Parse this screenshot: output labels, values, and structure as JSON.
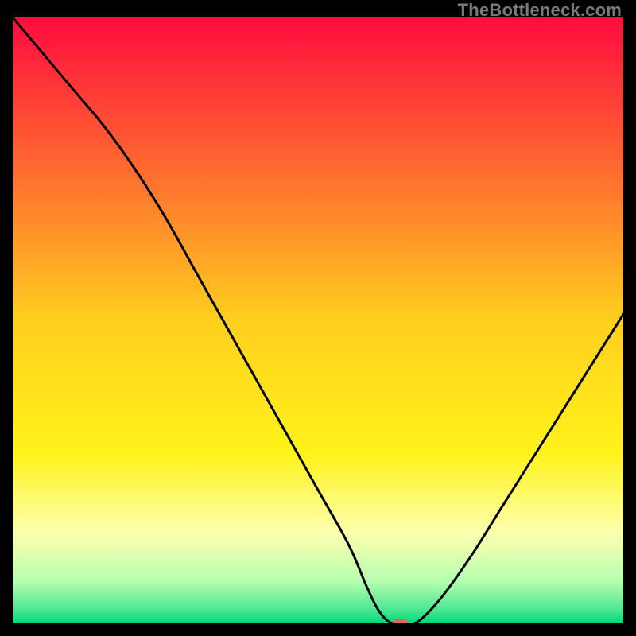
{
  "watermark": "TheBottleneck.com",
  "chart_data": {
    "type": "line",
    "title": "",
    "xlabel": "",
    "ylabel": "",
    "xlim": [
      0,
      100
    ],
    "ylim": [
      0,
      100
    ],
    "x": [
      0,
      5,
      10,
      15,
      20,
      25,
      30,
      35,
      40,
      45,
      50,
      55,
      58,
      60,
      62,
      64,
      66,
      70,
      75,
      80,
      85,
      90,
      95,
      100
    ],
    "values": [
      100,
      94,
      88,
      82,
      75,
      67,
      58,
      49,
      40,
      31,
      22,
      13,
      6,
      2,
      0,
      0,
      0,
      4,
      11,
      19,
      27,
      35,
      43,
      51
    ],
    "series_name": "bottleneck-curve",
    "gradient_stops": [
      {
        "offset": 0.0,
        "color": "#ff0b3e"
      },
      {
        "offset": 0.25,
        "color": "#ff6a30"
      },
      {
        "offset": 0.5,
        "color": "#ffcf1e"
      },
      {
        "offset": 0.72,
        "color": "#fff31a"
      },
      {
        "offset": 0.85,
        "color": "#fdffae"
      },
      {
        "offset": 0.93,
        "color": "#b6ffb0"
      },
      {
        "offset": 0.975,
        "color": "#52e894"
      },
      {
        "offset": 1.0,
        "color": "#00d879"
      }
    ],
    "marker": {
      "x": 63.5,
      "y": 0,
      "color": "#e06666",
      "rx": 10,
      "ry": 6
    }
  }
}
